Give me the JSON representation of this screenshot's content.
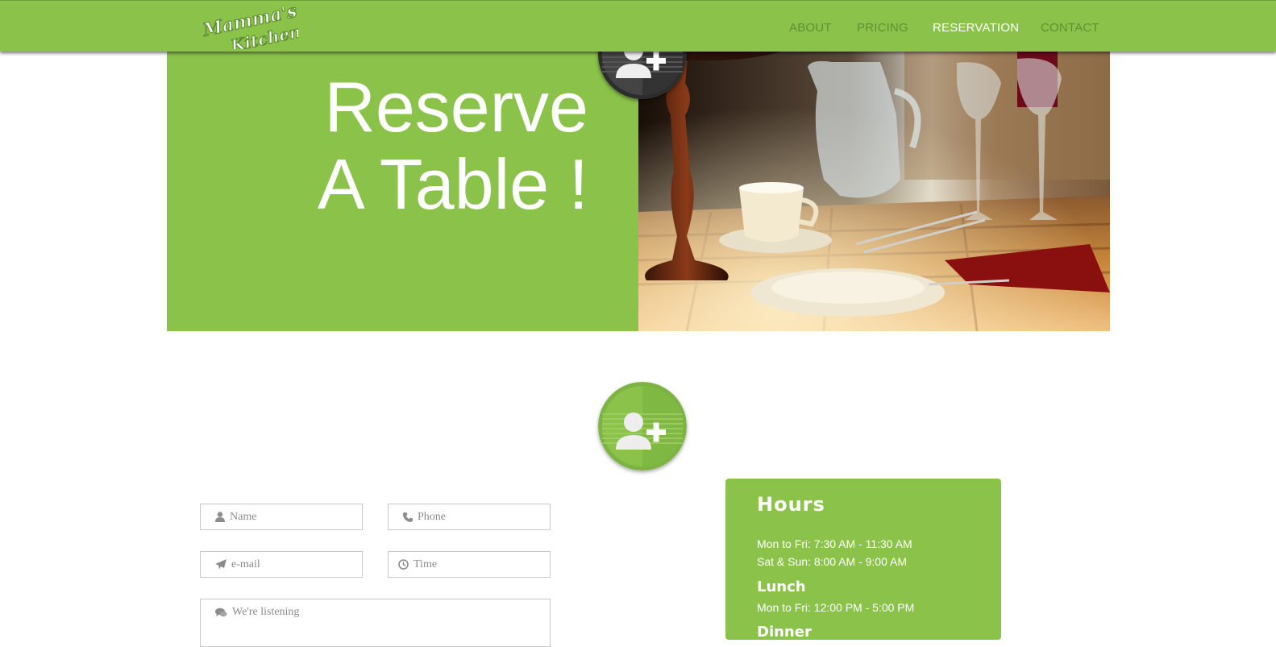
{
  "brand": {
    "logo_text_line1": "Mamma's",
    "logo_text_line2": "Kitchen"
  },
  "nav": {
    "items": [
      {
        "label": "ABOUT"
      },
      {
        "label": "PRICING"
      },
      {
        "label": "RESERVATION",
        "active": true
      },
      {
        "label": "CONTACT"
      }
    ]
  },
  "hero": {
    "title_line1": "Reserve",
    "title_line2": "A Table !"
  },
  "icons": {
    "reservation_badge": "add-user-icon",
    "name": "user-icon",
    "phone": "phone-icon",
    "email": "paper-plane-icon",
    "time": "clock-icon",
    "message": "comments-icon"
  },
  "form": {
    "name_placeholder": "Name",
    "phone_placeholder": "Phone",
    "email_placeholder": "e-mail",
    "time_placeholder": "Time",
    "message_placeholder": "We're listening"
  },
  "hours": {
    "title": "Hours",
    "breakfast_line1": "Mon to Fri: 7:30 AM - 11:30 AM",
    "breakfast_line2": "Sat & Sun: 8:00 AM - 9:00 AM",
    "lunch_heading": "Lunch",
    "lunch_line1": "Mon to Fri: 12:00 PM - 5:00 PM",
    "dinner_heading": "Dinner"
  },
  "colors": {
    "brand_green": "#8bc34a",
    "nav_link": "#5f8f35",
    "nav_active": "#ffffff",
    "badge_dark": "#3d3d3d"
  }
}
